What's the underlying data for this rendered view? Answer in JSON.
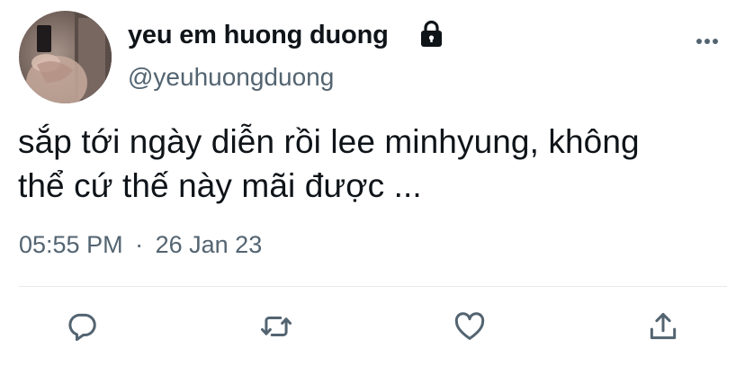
{
  "user": {
    "display_name": "yeu em huong duong",
    "handle": "@yeuhuongduong",
    "protected_icon": "lock-icon",
    "avatar_icon": "profile-photo"
  },
  "tweet": {
    "text_lines": [
      "sắp tới ngày diễn rồi lee minhyung, không",
      "thể cứ thế này mãi được ..."
    ]
  },
  "meta": {
    "time": "05:55 PM",
    "separator": "·",
    "date": "26 Jan 23"
  },
  "actions": [
    {
      "icon": "reply-icon"
    },
    {
      "icon": "retweet-icon"
    },
    {
      "icon": "like-icon"
    },
    {
      "icon": "share-icon"
    }
  ],
  "menu": {
    "icon": "more-icon"
  },
  "colors": {
    "text_primary": "#0f1419",
    "text_secondary": "#536471",
    "divider": "#e6e9eb"
  }
}
